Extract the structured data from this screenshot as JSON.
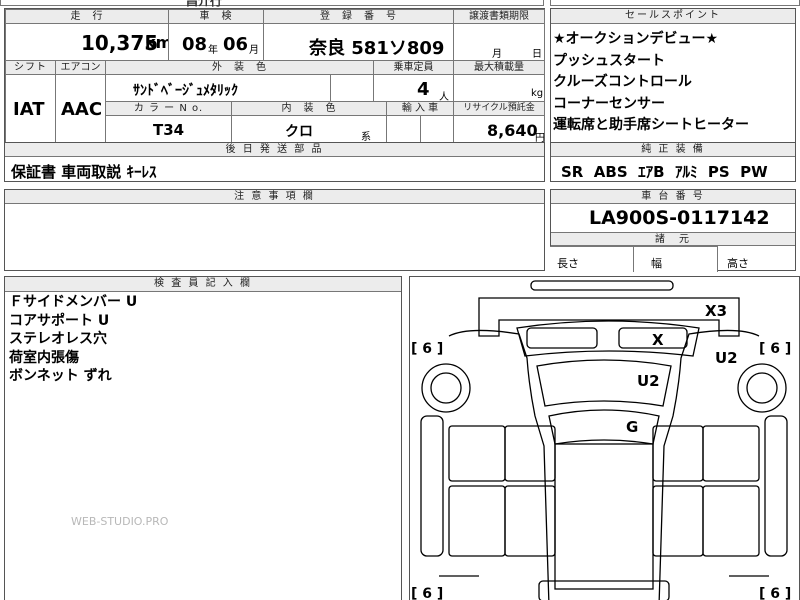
{
  "top_strip": {
    "partial": "昌介行"
  },
  "main": {
    "headers": {
      "mileage": "走　行",
      "inspection": "車　検",
      "registration": "登　録　番　号",
      "transfer_deadline": "譲渡書類期限",
      "shift": "シフト",
      "aircon": "エアコン",
      "exterior_color": "外　装　色",
      "capacity": "乗車定員",
      "max_load": "最大積載量",
      "color_no": "カ ラ ー N o.",
      "interior_color": "内　装　色",
      "import": "輸 入 車",
      "recycle": "リサイクル預託金"
    },
    "mileage": "10,375",
    "mileage_unit": "km",
    "inspection_year": "08",
    "year_unit": "年",
    "inspection_month": "06",
    "month_unit": "月",
    "registration": "奈良 581ソ809",
    "transfer_month_unit": "月",
    "transfer_day_unit": "日",
    "shift": "IAT",
    "aircon": "AAC",
    "exterior_color": "ｻﾝﾄﾞﾍﾞｰｼﾞｭﾒﾀﾘｯｸ",
    "capacity": "4",
    "capacity_unit": "人",
    "max_load_unit": "kg",
    "color_no": "T34",
    "interior_color": "クロ",
    "interior_suffix": "系",
    "recycle": "8,640",
    "recycle_unit": "円"
  },
  "later_parts": {
    "header": "後 日 発 送 部 品",
    "content": "保証書 車両取説 ｷｰﾚｽ"
  },
  "notes": {
    "header": "注 意 事 項 欄",
    "content": ""
  },
  "selling_points": {
    "header": "セールスポイント",
    "items": [
      "★オークションデビュー★",
      "プッシュスタート",
      "クルーズコントロール",
      "コーナーセンサー",
      "運転席と助手席シートヒーター"
    ]
  },
  "equipment": {
    "header": "純 正 装 備",
    "content": "SR  ABS  ｴｱB  ｱﾙﾐ  PS  PW"
  },
  "chassis": {
    "header": "車 台 番 号",
    "value": "LA900S-0117142"
  },
  "dimensions": {
    "header": "諸　元",
    "length": "長さ",
    "width": "幅",
    "height": "高さ"
  },
  "inspector": {
    "header": "検 査 員 記 入 欄",
    "lines": [
      "Ｆサイドメンバー U",
      "コアサポート U",
      "ステレオレス穴",
      "荷室内張傷",
      "ボンネット ずれ"
    ]
  },
  "diagram": {
    "marks": [
      {
        "code": "X3"
      },
      {
        "code": "X"
      },
      {
        "code": "U2"
      },
      {
        "code": "U2"
      },
      {
        "code": "G"
      }
    ],
    "tires": [
      "[ 6 ]",
      "[ 6 ]",
      "[ 6 ]",
      "[ 6 ]"
    ]
  },
  "watermark": "WEB-STUDIO.PRO"
}
